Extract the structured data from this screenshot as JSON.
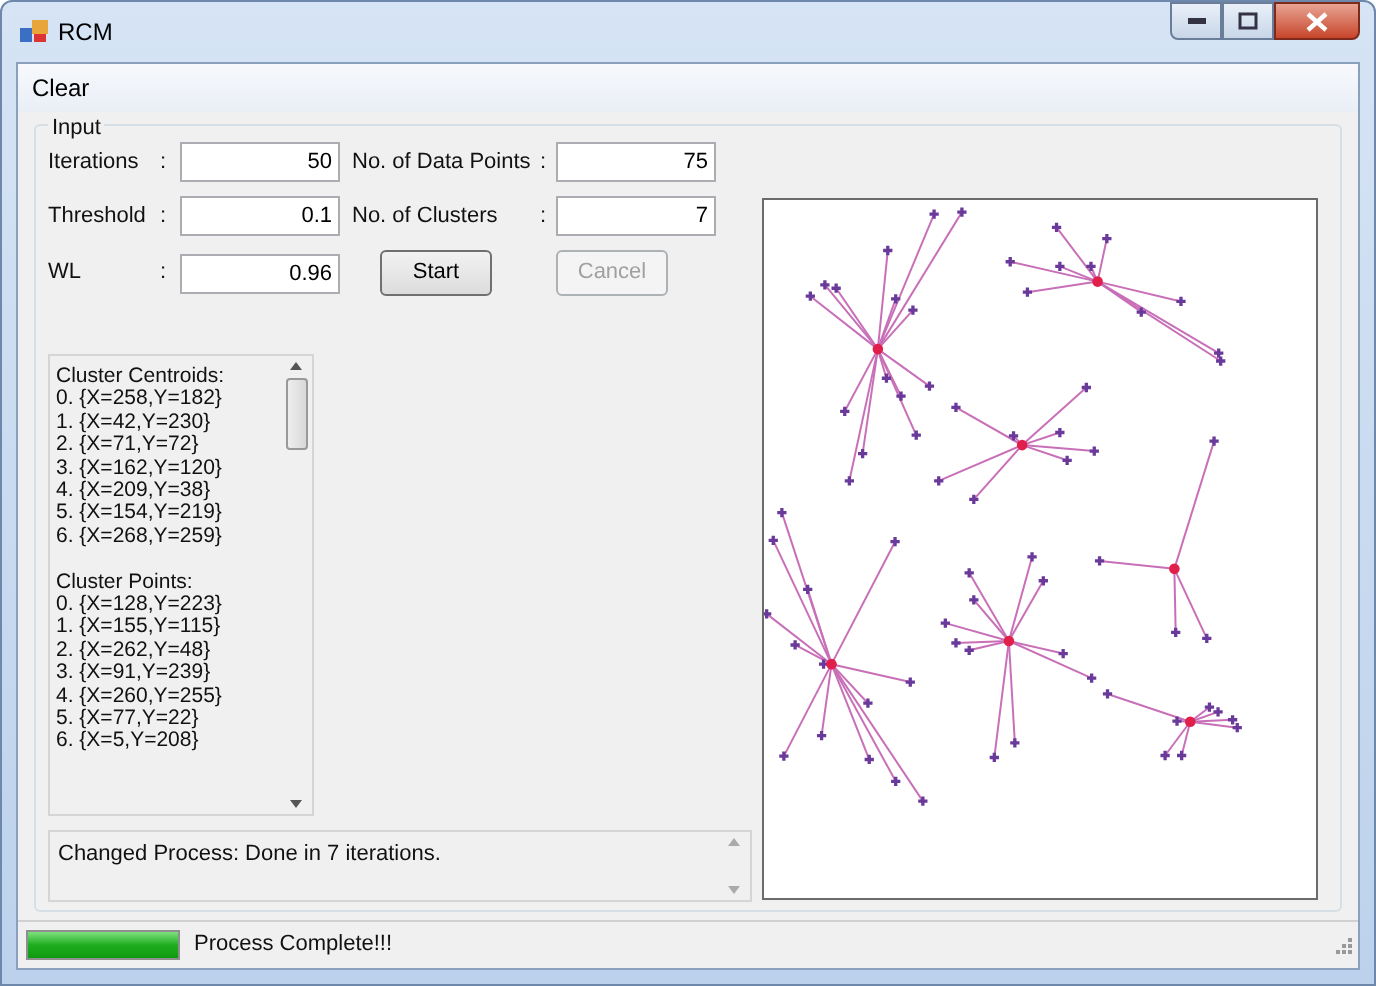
{
  "window": {
    "title": "RCM"
  },
  "menu": [
    "Clear"
  ],
  "input_group": {
    "title": "Input",
    "fields": [
      {
        "label": "Iterations",
        "separator": ":",
        "value": "50"
      },
      {
        "label": "No. of Data Points",
        "separator": ":",
        "value": "75"
      },
      {
        "label": "Threshold",
        "separator": ":",
        "value": "0.1"
      },
      {
        "label": "No. of Clusters",
        "separator": ":",
        "value": "7"
      },
      {
        "label": "WL",
        "separator": ":",
        "value": "0.96"
      }
    ],
    "buttons": [
      {
        "label": "Start",
        "disabled": false
      },
      {
        "label": "Cancel",
        "disabled": true
      }
    ]
  },
  "results_list": {
    "sections": [
      {
        "heading": "Cluster Centroids:",
        "items": [
          "0. {X=258,Y=182}",
          "1. {X=42,Y=230}",
          "2. {X=71,Y=72}",
          "3. {X=162,Y=120}",
          "4. {X=209,Y=38}",
          "5. {X=154,Y=219}",
          "6. {X=268,Y=259}"
        ]
      },
      {
        "heading": "Cluster Points:",
        "items": [
          "0. {X=128,Y=223}",
          "1. {X=155,Y=115}",
          "2. {X=262,Y=48}",
          "3. {X=91,Y=239}",
          "4. {X=260,Y=255}",
          "5. {X=77,Y=22}",
          "6. {X=5,Y=208}"
        ]
      }
    ]
  },
  "log": {
    "text": "Changed Process: Done in 7 iterations."
  },
  "status_bar": {
    "level": 1,
    "text": "Process Complete!!!"
  }
}
